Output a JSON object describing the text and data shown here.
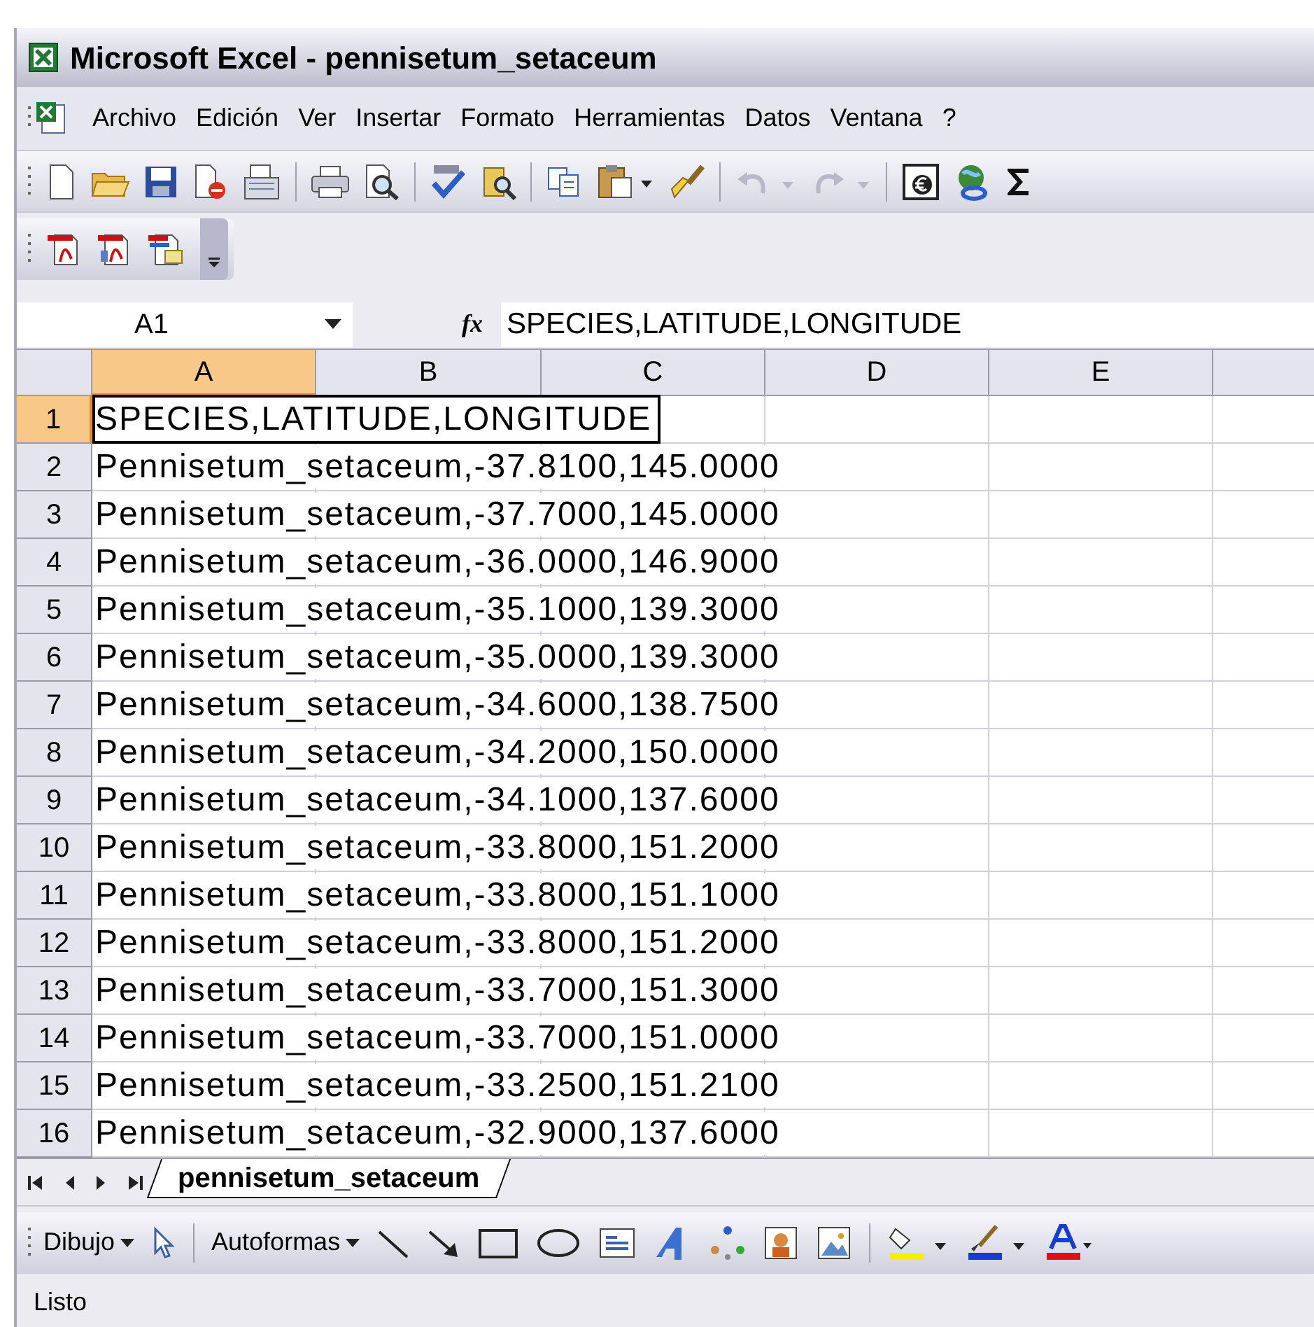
{
  "window": {
    "title": "Microsoft Excel - pennisetum_setaceum"
  },
  "menu": [
    "Archivo",
    "Edición",
    "Ver",
    "Insertar",
    "Formato",
    "Herramientas",
    "Datos",
    "Ventana",
    "?"
  ],
  "formula_bar": {
    "name_box": "A1",
    "fx": "fx",
    "content": "SPECIES,LATITUDE,LONGITUDE"
  },
  "columns": [
    {
      "label": "A",
      "selected": true
    },
    {
      "label": "B",
      "selected": false
    },
    {
      "label": "C",
      "selected": false
    },
    {
      "label": "D",
      "selected": false
    },
    {
      "label": "E",
      "selected": false
    }
  ],
  "rows": [
    {
      "number": "1",
      "selected": true,
      "text": "SPECIES,LATITUDE,LONGITUDE"
    },
    {
      "number": "2",
      "selected": false,
      "text": "Pennisetum_setaceum,-37.8100,145.0000"
    },
    {
      "number": "3",
      "selected": false,
      "text": "Pennisetum_setaceum,-37.7000,145.0000"
    },
    {
      "number": "4",
      "selected": false,
      "text": "Pennisetum_setaceum,-36.0000,146.9000"
    },
    {
      "number": "5",
      "selected": false,
      "text": "Pennisetum_setaceum,-35.1000,139.3000"
    },
    {
      "number": "6",
      "selected": false,
      "text": "Pennisetum_setaceum,-35.0000,139.3000"
    },
    {
      "number": "7",
      "selected": false,
      "text": "Pennisetum_setaceum,-34.6000,138.7500"
    },
    {
      "number": "8",
      "selected": false,
      "text": "Pennisetum_setaceum,-34.2000,150.0000"
    },
    {
      "number": "9",
      "selected": false,
      "text": "Pennisetum_setaceum,-34.1000,137.6000"
    },
    {
      "number": "10",
      "selected": false,
      "text": "Pennisetum_setaceum,-33.8000,151.2000"
    },
    {
      "number": "11",
      "selected": false,
      "text": "Pennisetum_setaceum,-33.8000,151.1000"
    },
    {
      "number": "12",
      "selected": false,
      "text": "Pennisetum_setaceum,-33.8000,151.2000"
    },
    {
      "number": "13",
      "selected": false,
      "text": "Pennisetum_setaceum,-33.7000,151.3000"
    },
    {
      "number": "14",
      "selected": false,
      "text": "Pennisetum_setaceum,-33.7000,151.0000"
    },
    {
      "number": "15",
      "selected": false,
      "text": "Pennisetum_setaceum,-33.2500,151.2100"
    },
    {
      "number": "16",
      "selected": false,
      "text": "Pennisetum_setaceum,-32.9000,137.6000"
    }
  ],
  "sheet_tabs": [
    {
      "label": "pennisetum_setaceum",
      "selected": true
    }
  ],
  "drawing_toolbar": {
    "draw_menu": "Dibujo",
    "autoshapes_menu": "Autoformas"
  },
  "status_bar": "Listo"
}
